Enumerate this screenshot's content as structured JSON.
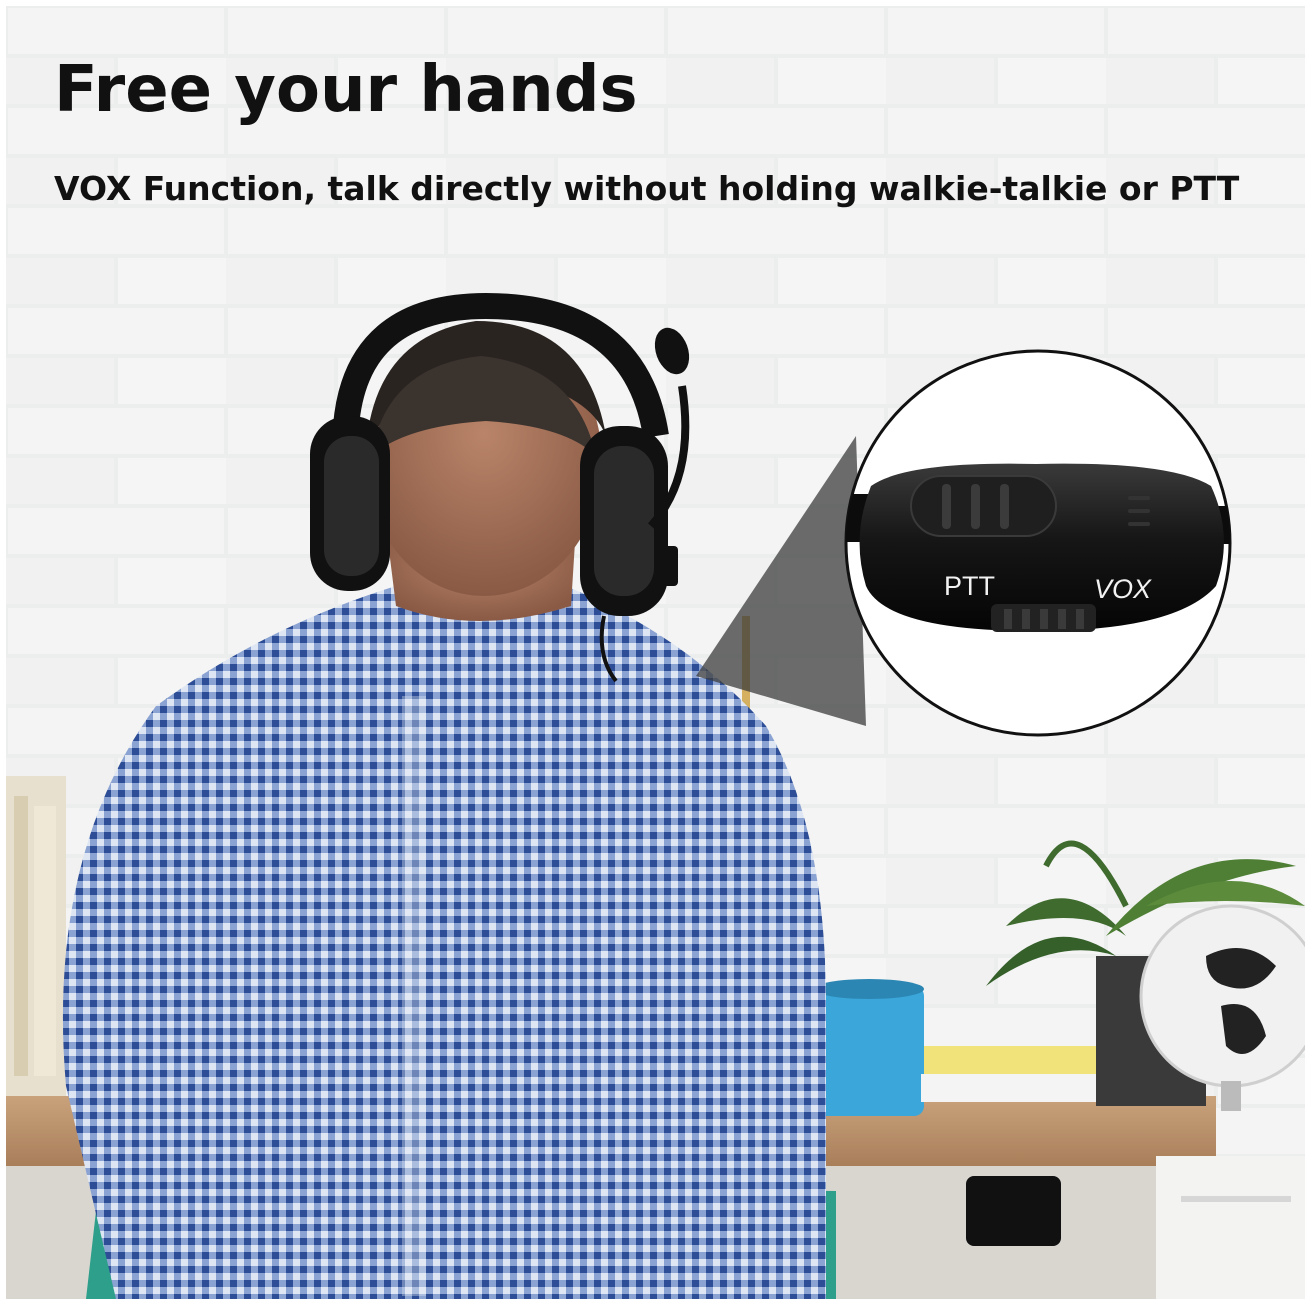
{
  "headline": "Free your hands",
  "subheadline": "VOX Function, talk directly without holding walkie-talkie or PTT",
  "callout": {
    "label_left": "PTT",
    "label_right": "VOX"
  },
  "colors": {
    "text": "#111111",
    "wall": "#e9ebe9",
    "shirt_blue": "#3d5fa8",
    "chair_teal": "#2e9f8a",
    "mug_blue": "#3aa6d9"
  }
}
